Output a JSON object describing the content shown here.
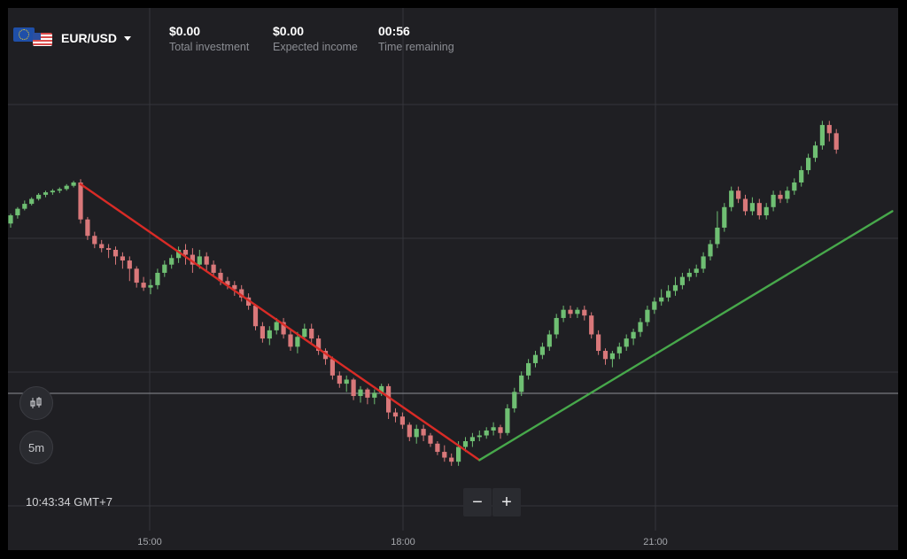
{
  "header": {
    "asset": {
      "name": "EUR/USD",
      "flag_icons": [
        "eu-flag-icon",
        "us-flag-icon"
      ]
    },
    "stats": [
      {
        "value": "$0.00",
        "label": "Total investment"
      },
      {
        "value": "$0.00",
        "label": "Expected income"
      },
      {
        "value": "00:56",
        "label": "Time remaining"
      }
    ]
  },
  "sidebar": {
    "chart_type_icon": "candlestick-icon",
    "timeframe": "5m"
  },
  "footer": {
    "clock": "10:43:34 GMT+7",
    "zoom_out": "−",
    "zoom_in": "+"
  },
  "colors": {
    "background": "#1f1f23",
    "up": "#6fbf73",
    "down": "#d9787a",
    "downtrend": "#d92b26",
    "uptrend": "#47a84b"
  },
  "chart_data": {
    "type": "candlestick",
    "x_ticks": [
      "15:00",
      "18:00",
      "21:00"
    ],
    "candles": [
      [
        0.6,
        0.7,
        0.55,
        0.72
      ],
      [
        0.7,
        0.78,
        0.66,
        0.8
      ],
      [
        0.78,
        0.84,
        0.76,
        0.88
      ],
      [
        0.84,
        0.9,
        0.82,
        0.92
      ],
      [
        0.9,
        0.95,
        0.88,
        0.97
      ],
      [
        0.95,
        0.98,
        0.92,
        1.0
      ],
      [
        0.98,
        1.0,
        0.95,
        1.02
      ],
      [
        1.0,
        1.02,
        0.97,
        1.04
      ],
      [
        1.02,
        1.06,
        1.0,
        1.08
      ],
      [
        1.06,
        1.1,
        1.04,
        1.12
      ],
      [
        1.1,
        0.65,
        0.6,
        1.14
      ],
      [
        0.65,
        0.45,
        0.4,
        0.68
      ],
      [
        0.45,
        0.35,
        0.3,
        0.5
      ],
      [
        0.35,
        0.3,
        0.25,
        0.4
      ],
      [
        0.3,
        0.28,
        0.18,
        0.35
      ],
      [
        0.28,
        0.2,
        0.1,
        0.32
      ],
      [
        0.2,
        0.15,
        0.05,
        0.25
      ],
      [
        0.15,
        0.05,
        -0.1,
        0.2
      ],
      [
        0.05,
        -0.12,
        -0.18,
        0.08
      ],
      [
        -0.12,
        -0.18,
        -0.22,
        -0.05
      ],
      [
        -0.18,
        -0.15,
        -0.26,
        -0.08
      ],
      [
        -0.15,
        0.0,
        -0.2,
        0.05
      ],
      [
        0.0,
        0.1,
        -0.05,
        0.15
      ],
      [
        0.1,
        0.18,
        0.05,
        0.22
      ],
      [
        0.18,
        0.28,
        0.12,
        0.32
      ],
      [
        0.28,
        0.22,
        0.1,
        0.35
      ],
      [
        0.22,
        0.1,
        0.0,
        0.3
      ],
      [
        0.1,
        0.2,
        0.05,
        0.28
      ],
      [
        0.2,
        0.1,
        0.02,
        0.25
      ],
      [
        0.1,
        0.0,
        -0.05,
        0.15
      ],
      [
        0.0,
        -0.1,
        -0.15,
        0.05
      ],
      [
        -0.1,
        -0.15,
        -0.2,
        -0.05
      ],
      [
        -0.15,
        -0.2,
        -0.28,
        -0.1
      ],
      [
        -0.2,
        -0.3,
        -0.35,
        -0.15
      ],
      [
        -0.3,
        -0.4,
        -0.45,
        -0.25
      ],
      [
        -0.4,
        -0.65,
        -0.7,
        -0.38
      ],
      [
        -0.65,
        -0.8,
        -0.85,
        -0.6
      ],
      [
        -0.8,
        -0.7,
        -0.88,
        -0.65
      ],
      [
        -0.7,
        -0.6,
        -0.75,
        -0.55
      ],
      [
        -0.6,
        -0.75,
        -0.8,
        -0.55
      ],
      [
        -0.75,
        -0.9,
        -0.95,
        -0.7
      ],
      [
        -0.9,
        -0.78,
        -0.98,
        -0.72
      ],
      [
        -0.78,
        -0.68,
        -0.82,
        -0.62
      ],
      [
        -0.68,
        -0.8,
        -0.85,
        -0.62
      ],
      [
        -0.8,
        -0.95,
        -1.0,
        -0.76
      ],
      [
        -0.95,
        -1.05,
        -1.12,
        -0.92
      ],
      [
        -1.05,
        -1.25,
        -1.3,
        -1.02
      ],
      [
        -1.25,
        -1.35,
        -1.4,
        -1.2
      ],
      [
        -1.35,
        -1.3,
        -1.45,
        -1.25
      ],
      [
        -1.3,
        -1.5,
        -1.55,
        -1.28
      ],
      [
        -1.5,
        -1.42,
        -1.58,
        -1.38
      ],
      [
        -1.42,
        -1.52,
        -1.6,
        -1.4
      ],
      [
        -1.52,
        -1.46,
        -1.6,
        -1.42
      ],
      [
        -1.46,
        -1.38,
        -1.5,
        -1.35
      ],
      [
        -1.38,
        -1.7,
        -1.78,
        -1.35
      ],
      [
        -1.7,
        -1.75,
        -1.82,
        -1.65
      ],
      [
        -1.75,
        -1.85,
        -1.9,
        -1.7
      ],
      [
        -1.85,
        -2.0,
        -2.05,
        -1.82
      ],
      [
        -2.0,
        -1.9,
        -2.08,
        -1.85
      ],
      [
        -1.9,
        -1.98,
        -2.05,
        -1.85
      ],
      [
        -1.98,
        -2.08,
        -2.12,
        -1.95
      ],
      [
        -2.08,
        -2.18,
        -2.22,
        -2.05
      ],
      [
        -2.18,
        -2.25,
        -2.3,
        -2.1
      ],
      [
        -2.25,
        -2.3,
        -2.35,
        -2.2
      ],
      [
        -2.3,
        -2.12,
        -2.35,
        -2.05
      ],
      [
        -2.12,
        -2.05,
        -2.18,
        -2.0
      ],
      [
        -2.05,
        -2.0,
        -2.12,
        -1.95
      ],
      [
        -2.0,
        -1.98,
        -2.05,
        -1.92
      ],
      [
        -1.98,
        -1.92,
        -2.02,
        -1.88
      ],
      [
        -1.92,
        -1.88,
        -1.98,
        -1.82
      ],
      [
        -1.88,
        -1.95,
        -2.02,
        -1.85
      ],
      [
        -1.95,
        -1.65,
        -1.98,
        -1.6
      ],
      [
        -1.65,
        -1.45,
        -1.7,
        -1.4
      ],
      [
        -1.45,
        -1.25,
        -1.5,
        -1.2
      ],
      [
        -1.25,
        -1.1,
        -1.3,
        -1.05
      ],
      [
        -1.1,
        -1.0,
        -1.15,
        -0.95
      ],
      [
        -1.0,
        -0.9,
        -1.05,
        -0.85
      ],
      [
        -0.9,
        -0.75,
        -0.95,
        -0.7
      ],
      [
        -0.75,
        -0.55,
        -0.8,
        -0.5
      ],
      [
        -0.55,
        -0.45,
        -0.6,
        -0.4
      ],
      [
        -0.45,
        -0.5,
        -0.55,
        -0.4
      ],
      [
        -0.5,
        -0.45,
        -0.55,
        -0.42
      ],
      [
        -0.45,
        -0.52,
        -0.58,
        -0.4
      ],
      [
        -0.52,
        -0.75,
        -0.8,
        -0.48
      ],
      [
        -0.75,
        -0.95,
        -1.0,
        -0.7
      ],
      [
        -0.95,
        -1.05,
        -1.12,
        -0.92
      ],
      [
        -1.05,
        -0.98,
        -1.15,
        -0.95
      ],
      [
        -0.98,
        -0.9,
        -1.05,
        -0.85
      ],
      [
        -0.9,
        -0.8,
        -0.95,
        -0.75
      ],
      [
        -0.8,
        -0.72,
        -0.88,
        -0.68
      ],
      [
        -0.72,
        -0.6,
        -0.78,
        -0.55
      ],
      [
        -0.6,
        -0.45,
        -0.65,
        -0.4
      ],
      [
        -0.45,
        -0.35,
        -0.5,
        -0.3
      ],
      [
        -0.35,
        -0.3,
        -0.4,
        -0.2
      ],
      [
        -0.3,
        -0.22,
        -0.35,
        -0.15
      ],
      [
        -0.22,
        -0.15,
        -0.28,
        -0.05
      ],
      [
        -0.15,
        -0.05,
        -0.2,
        0.0
      ],
      [
        -0.05,
        0.0,
        -0.1,
        0.05
      ],
      [
        0.0,
        0.05,
        -0.05,
        0.1
      ],
      [
        0.05,
        0.2,
        0.0,
        0.25
      ],
      [
        0.2,
        0.35,
        0.15,
        0.4
      ],
      [
        0.35,
        0.55,
        0.3,
        0.75
      ],
      [
        0.55,
        0.8,
        0.5,
        0.85
      ],
      [
        0.8,
        1.0,
        0.75,
        1.05
      ],
      [
        1.0,
        0.9,
        0.85,
        1.05
      ],
      [
        0.9,
        0.75,
        0.7,
        0.95
      ],
      [
        0.75,
        0.85,
        0.7,
        0.92
      ],
      [
        0.85,
        0.7,
        0.65,
        0.9
      ],
      [
        0.7,
        0.8,
        0.65,
        0.85
      ],
      [
        0.8,
        0.95,
        0.75,
        1.0
      ],
      [
        0.95,
        0.9,
        0.85,
        1.0
      ],
      [
        0.9,
        1.0,
        0.85,
        1.05
      ],
      [
        1.0,
        1.1,
        0.95,
        1.15
      ],
      [
        1.1,
        1.25,
        1.05,
        1.3
      ],
      [
        1.25,
        1.4,
        1.2,
        1.45
      ],
      [
        1.4,
        1.55,
        1.35,
        1.6
      ],
      [
        1.55,
        1.8,
        1.5,
        1.85
      ],
      [
        1.8,
        1.7,
        1.6,
        1.85
      ],
      [
        1.7,
        1.5,
        1.45,
        1.75
      ]
    ],
    "trendlines": [
      {
        "from": [
          10,
          1.08
        ],
        "to": [
          67,
          -2.28
        ],
        "color": "#d92b26"
      },
      {
        "from": [
          67,
          -2.28
        ],
        "to": [
          126,
          0.75
        ],
        "color": "#47a84b"
      }
    ]
  }
}
